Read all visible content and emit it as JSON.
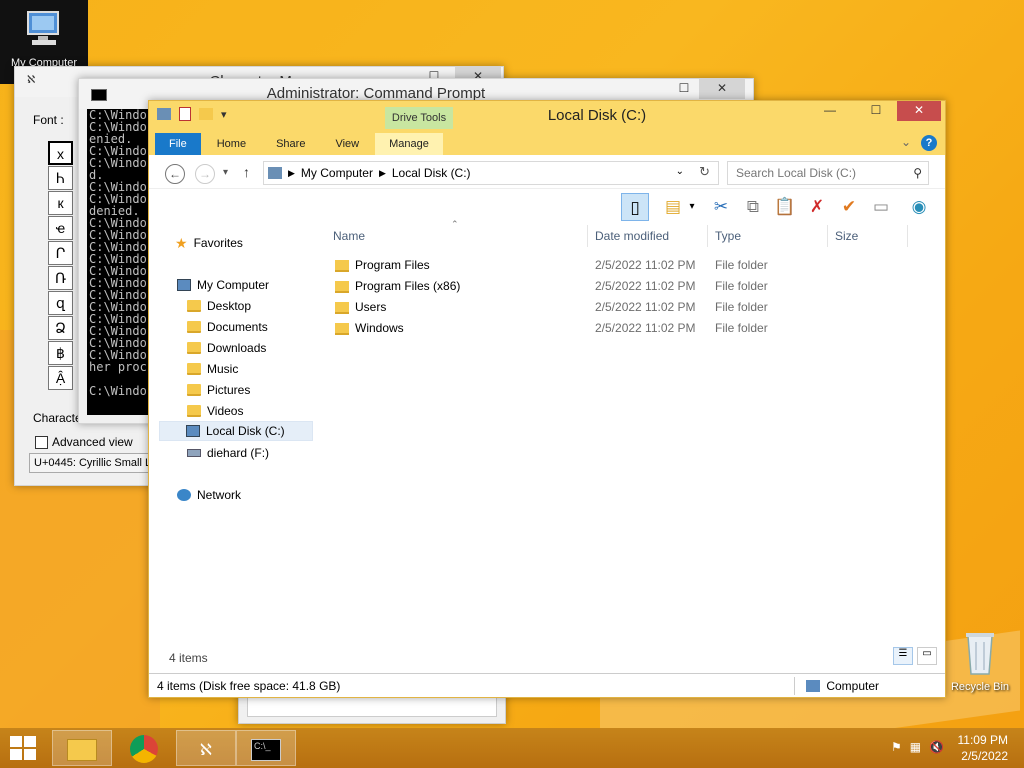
{
  "desktop": {
    "mycomputer_label": "My Computer",
    "recycle_label": "Recycle Bin"
  },
  "charmap": {
    "title": "Character Map",
    "font_label": "Font :",
    "chars": [
      "х",
      "Ꮒ",
      "к",
      "ҽ",
      "Ր",
      "Ռ",
      "զ",
      "Ձ",
      "฿",
      "Ậ"
    ],
    "characters_to_copy_label": "Characte",
    "advanced_view_label": "Advanced view",
    "status": "U+0445: Cyrillic Small Le"
  },
  "cmd": {
    "title": "Administrator: Command Prompt",
    "lines": [
      "C:\\Windo",
      "C:\\Windo",
      "enied.",
      "C:\\Windo",
      "C:\\Windo",
      "d.",
      "C:\\Windo",
      "C:\\Windo",
      "denied.",
      "C:\\Windo",
      "C:\\Windo",
      "C:\\Windo",
      "C:\\Windo",
      "C:\\Windo",
      "C:\\Windo",
      "C:\\Windo",
      "C:\\Windo",
      "C:\\Windo",
      "C:\\Windo",
      "C:\\Windo",
      "C:\\Windo",
      "her proc",
      "",
      "C:\\Windo"
    ]
  },
  "explorer": {
    "title": "Local Disk (C:)",
    "context_tab_group": "Drive Tools",
    "tabs": {
      "file": "File",
      "home": "Home",
      "share": "Share",
      "view": "View",
      "manage": "Manage"
    },
    "address": {
      "crumb1": "My Computer",
      "crumb2": "Local Disk (C:)"
    },
    "search_placeholder": "Search Local Disk (C:)",
    "sidebar": {
      "favorites": "Favorites",
      "my_computer": "My Computer",
      "desktop": "Desktop",
      "documents": "Documents",
      "downloads": "Downloads",
      "music": "Music",
      "pictures": "Pictures",
      "videos": "Videos",
      "local_disk": "Local Disk (C:)",
      "diehard": "diehard (F:)",
      "network": "Network"
    },
    "columns": {
      "name": "Name",
      "date": "Date modified",
      "type": "Type",
      "size": "Size"
    },
    "rows": [
      {
        "name": "Program Files",
        "date": "2/5/2022 11:02 PM",
        "type": "File folder"
      },
      {
        "name": "Program Files (x86)",
        "date": "2/5/2022 11:02 PM",
        "type": "File folder"
      },
      {
        "name": "Users",
        "date": "2/5/2022 11:02 PM",
        "type": "File folder"
      },
      {
        "name": "Windows",
        "date": "2/5/2022 11:02 PM",
        "type": "File folder"
      }
    ],
    "item_count": "4 items",
    "status_left": "4 items (Disk free space: 41.8 GB)",
    "status_right": "Computer"
  },
  "taskbar": {
    "time": "11:09 PM",
    "date": "2/5/2022"
  }
}
